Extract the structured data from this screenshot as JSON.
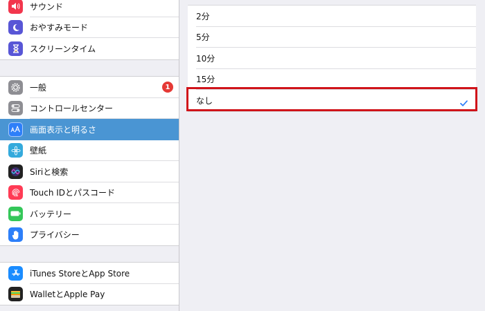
{
  "sidebar": {
    "group1": [
      {
        "label": "サウンド",
        "icon": "speaker-icon",
        "color": "#f2364d"
      },
      {
        "label": "おやすみモード",
        "icon": "moon-icon",
        "color": "#5856d6"
      },
      {
        "label": "スクリーンタイム",
        "icon": "hourglass-icon",
        "color": "#5856d6"
      }
    ],
    "group2": [
      {
        "label": "一般",
        "icon": "gear-icon",
        "color": "#8e8e93",
        "badge": "1"
      },
      {
        "label": "コントロールセンター",
        "icon": "toggles-icon",
        "color": "#8e8e93"
      },
      {
        "label": "画面表示と明るさ",
        "icon": "text-size-icon",
        "color": "#2d7ff9",
        "selected": true
      },
      {
        "label": "壁紙",
        "icon": "wallpaper-flower-icon",
        "color": "#34aadc"
      },
      {
        "label": "Siriと検索",
        "icon": "siri-icon",
        "color": "#222222"
      },
      {
        "label": "Touch IDとパスコード",
        "icon": "fingerprint-icon",
        "color": "#ff3b55"
      },
      {
        "label": "バッテリー",
        "icon": "battery-icon",
        "color": "#34c759"
      },
      {
        "label": "プライバシー",
        "icon": "hand-icon",
        "color": "#2d7ff9"
      }
    ],
    "group3": [
      {
        "label": "iTunes StoreとApp Store",
        "icon": "app-store-icon",
        "color": "#1a8cff"
      },
      {
        "label": "WalletとApple Pay",
        "icon": "wallet-icon",
        "color": "#222222"
      }
    ]
  },
  "detail": {
    "options": [
      {
        "label": "2分"
      },
      {
        "label": "5分"
      },
      {
        "label": "10分"
      },
      {
        "label": "15分"
      },
      {
        "label": "なし",
        "checked": true
      }
    ],
    "check_color": "#2d7ff9",
    "highlight_color": "#d0131a"
  }
}
